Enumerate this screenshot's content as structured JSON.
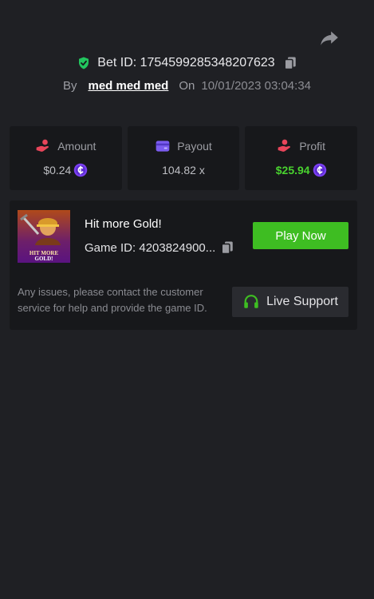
{
  "header": {
    "share_icon": "share-arrow-icon",
    "bet_id_label": "Bet ID: 1754599285348207623",
    "by_label": "By",
    "username": "med med med",
    "on_label": "On",
    "date": "10/01/2023 03:04:34"
  },
  "stats": [
    {
      "label": "Amount",
      "value": "$0.24",
      "icon": "hand-coin-icon",
      "icon_color": "#e8455a",
      "has_coin": true
    },
    {
      "label": "Payout",
      "value": "104.82 x",
      "icon": "wallet-card-icon",
      "icon_color": "#7b5cf0",
      "has_coin": false
    },
    {
      "label": "Profit",
      "value": "$25.94",
      "icon": "hand-money-icon",
      "icon_color": "#e8455a",
      "has_coin": true
    }
  ],
  "game": {
    "title": "Hit more Gold!",
    "game_id": "Game ID: 4203824900...",
    "play_label": "Play Now",
    "thumbnail_text": "HIT MORE GOLD!",
    "notice": "Any issues, please contact the customer service for help and provide the game ID.",
    "support_label": "Live Support"
  },
  "colors": {
    "background": "#1f2024",
    "panel": "#17181b",
    "accent_green": "#3ebd22",
    "profit_green": "#49d22f",
    "coin_purple": "#7b3ff2",
    "shield_green": "#22c55e"
  }
}
